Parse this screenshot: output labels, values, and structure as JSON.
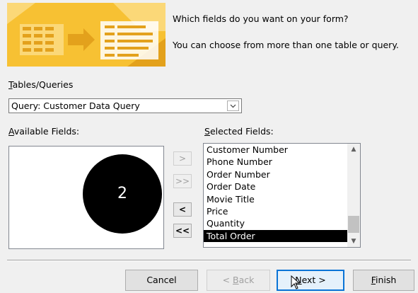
{
  "header": {
    "line1": "Which fields do you want on your form?",
    "line2": "You can choose from more than one table or query."
  },
  "tables_queries": {
    "label_mnemonic": "T",
    "label_rest": "ables/Queries",
    "selected": "Query: Customer Data Query"
  },
  "available": {
    "label_mnemonic": "A",
    "label_rest": "vailable Fields:",
    "items": []
  },
  "selected_fields": {
    "label_mnemonic": "S",
    "label_rest": "elected Fields:",
    "items": [
      "Customer Number",
      "Phone Number",
      "Order Number",
      "Order Date",
      "Movie Title",
      "Price",
      "Quantity",
      "Total Order"
    ],
    "highlighted": "Total Order"
  },
  "move_buttons": {
    "add_one": ">",
    "add_all": ">>",
    "remove_one": "<",
    "remove_all": "<<"
  },
  "marker": {
    "label": "2"
  },
  "buttons": {
    "cancel": "Cancel",
    "back_prefix": "< ",
    "back_mnemonic": "B",
    "back_rest": "ack",
    "next_mnemonic": "N",
    "next_rest": "ext >",
    "finish_mnemonic": "F",
    "finish_rest": "inish"
  },
  "colors": {
    "banner": "#f7c133",
    "selection": "#000000",
    "focus_border": "#0a74d6"
  }
}
